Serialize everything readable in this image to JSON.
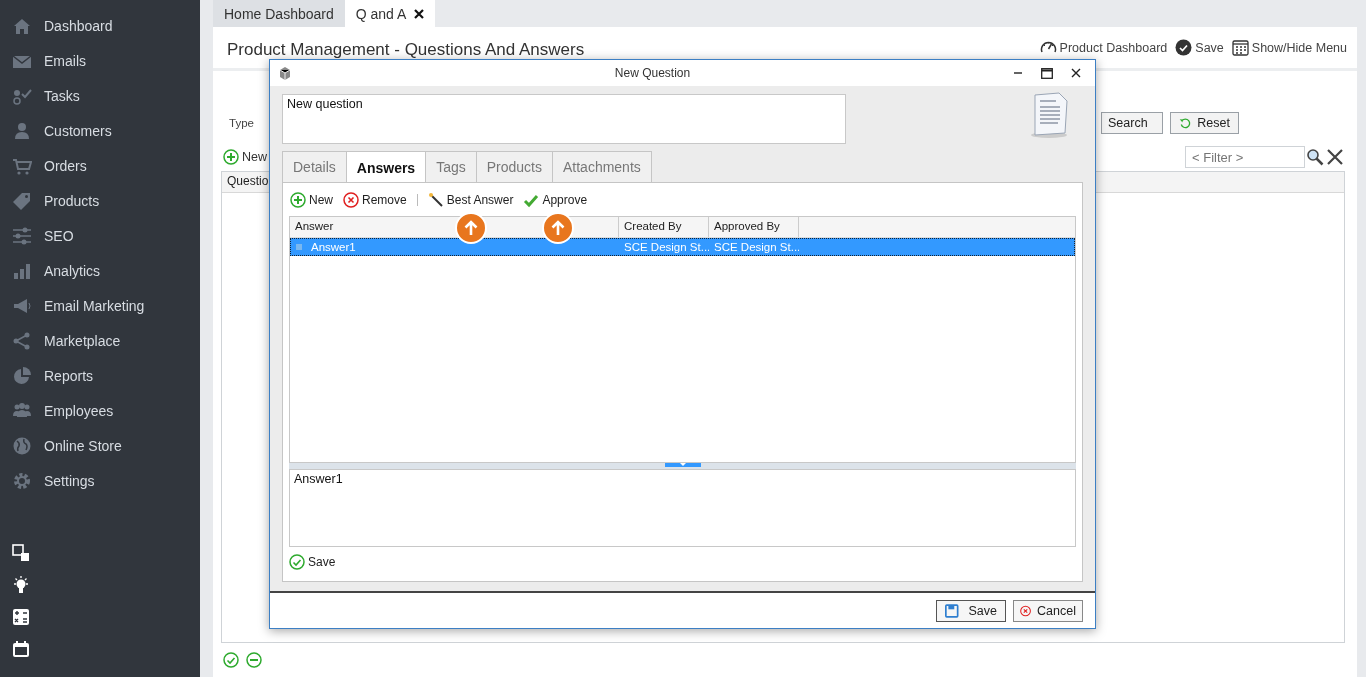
{
  "sidebar": {
    "items": [
      {
        "label": "Dashboard"
      },
      {
        "label": "Emails"
      },
      {
        "label": "Tasks"
      },
      {
        "label": "Customers"
      },
      {
        "label": "Orders"
      },
      {
        "label": "Products"
      },
      {
        "label": "SEO"
      },
      {
        "label": "Analytics"
      },
      {
        "label": "Email Marketing"
      },
      {
        "label": "Marketplace"
      },
      {
        "label": "Reports"
      },
      {
        "label": "Employees"
      },
      {
        "label": "Online Store"
      },
      {
        "label": "Settings"
      }
    ]
  },
  "tabs": [
    {
      "label": "Home Dashboard",
      "selected": false,
      "closable": false
    },
    {
      "label": "Q and A",
      "selected": true,
      "closable": true
    }
  ],
  "page": {
    "title": "Product Management - Questions And Answers",
    "actions": [
      {
        "label": "Product Dashboard"
      },
      {
        "label": "Save"
      },
      {
        "label": "Show/Hide Menu"
      }
    ]
  },
  "filter_form": {
    "type_label": "Type",
    "search": "Search",
    "reset": "Reset"
  },
  "list": {
    "new": "New",
    "filter_placeholder": "< Filter >",
    "columns": [
      "Questio"
    ]
  },
  "dialog": {
    "title": "New Question",
    "question": "New question",
    "tabs": [
      {
        "label": "Details",
        "selected": false
      },
      {
        "label": "Answers",
        "selected": true
      },
      {
        "label": "Tags",
        "selected": false
      },
      {
        "label": "Products",
        "selected": false
      },
      {
        "label": "Attachments",
        "selected": false
      }
    ],
    "toolbar": [
      {
        "label": "New"
      },
      {
        "label": "Remove"
      },
      {
        "label": "Best Answer"
      },
      {
        "label": "Approve"
      }
    ],
    "columns": [
      "Answer",
      "Created By",
      "Approved By"
    ],
    "rows": [
      {
        "cells": [
          "Answer1",
          "SCE Design St...",
          "SCE Design St..."
        ],
        "selected": true
      }
    ],
    "answer_text": "Answer1",
    "save_answer": "Save",
    "buttons": [
      {
        "label": "Save"
      },
      {
        "label": "Cancel"
      }
    ]
  }
}
